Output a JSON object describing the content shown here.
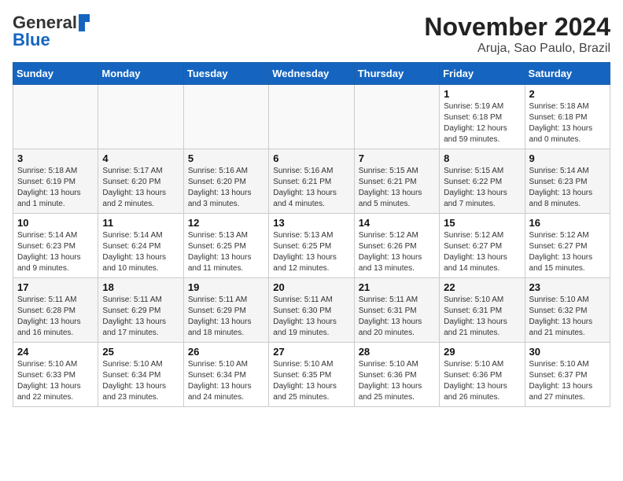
{
  "header": {
    "logo_general": "General",
    "logo_blue": "Blue",
    "title": "November 2024",
    "subtitle": "Aruja, Sao Paulo, Brazil"
  },
  "weekdays": [
    "Sunday",
    "Monday",
    "Tuesday",
    "Wednesday",
    "Thursday",
    "Friday",
    "Saturday"
  ],
  "weeks": [
    [
      {
        "day": "",
        "info": ""
      },
      {
        "day": "",
        "info": ""
      },
      {
        "day": "",
        "info": ""
      },
      {
        "day": "",
        "info": ""
      },
      {
        "day": "",
        "info": ""
      },
      {
        "day": "1",
        "info": "Sunrise: 5:19 AM\nSunset: 6:18 PM\nDaylight: 12 hours\nand 59 minutes."
      },
      {
        "day": "2",
        "info": "Sunrise: 5:18 AM\nSunset: 6:18 PM\nDaylight: 13 hours\nand 0 minutes."
      }
    ],
    [
      {
        "day": "3",
        "info": "Sunrise: 5:18 AM\nSunset: 6:19 PM\nDaylight: 13 hours\nand 1 minute."
      },
      {
        "day": "4",
        "info": "Sunrise: 5:17 AM\nSunset: 6:20 PM\nDaylight: 13 hours\nand 2 minutes."
      },
      {
        "day": "5",
        "info": "Sunrise: 5:16 AM\nSunset: 6:20 PM\nDaylight: 13 hours\nand 3 minutes."
      },
      {
        "day": "6",
        "info": "Sunrise: 5:16 AM\nSunset: 6:21 PM\nDaylight: 13 hours\nand 4 minutes."
      },
      {
        "day": "7",
        "info": "Sunrise: 5:15 AM\nSunset: 6:21 PM\nDaylight: 13 hours\nand 5 minutes."
      },
      {
        "day": "8",
        "info": "Sunrise: 5:15 AM\nSunset: 6:22 PM\nDaylight: 13 hours\nand 7 minutes."
      },
      {
        "day": "9",
        "info": "Sunrise: 5:14 AM\nSunset: 6:23 PM\nDaylight: 13 hours\nand 8 minutes."
      }
    ],
    [
      {
        "day": "10",
        "info": "Sunrise: 5:14 AM\nSunset: 6:23 PM\nDaylight: 13 hours\nand 9 minutes."
      },
      {
        "day": "11",
        "info": "Sunrise: 5:14 AM\nSunset: 6:24 PM\nDaylight: 13 hours\nand 10 minutes."
      },
      {
        "day": "12",
        "info": "Sunrise: 5:13 AM\nSunset: 6:25 PM\nDaylight: 13 hours\nand 11 minutes."
      },
      {
        "day": "13",
        "info": "Sunrise: 5:13 AM\nSunset: 6:25 PM\nDaylight: 13 hours\nand 12 minutes."
      },
      {
        "day": "14",
        "info": "Sunrise: 5:12 AM\nSunset: 6:26 PM\nDaylight: 13 hours\nand 13 minutes."
      },
      {
        "day": "15",
        "info": "Sunrise: 5:12 AM\nSunset: 6:27 PM\nDaylight: 13 hours\nand 14 minutes."
      },
      {
        "day": "16",
        "info": "Sunrise: 5:12 AM\nSunset: 6:27 PM\nDaylight: 13 hours\nand 15 minutes."
      }
    ],
    [
      {
        "day": "17",
        "info": "Sunrise: 5:11 AM\nSunset: 6:28 PM\nDaylight: 13 hours\nand 16 minutes."
      },
      {
        "day": "18",
        "info": "Sunrise: 5:11 AM\nSunset: 6:29 PM\nDaylight: 13 hours\nand 17 minutes."
      },
      {
        "day": "19",
        "info": "Sunrise: 5:11 AM\nSunset: 6:29 PM\nDaylight: 13 hours\nand 18 minutes."
      },
      {
        "day": "20",
        "info": "Sunrise: 5:11 AM\nSunset: 6:30 PM\nDaylight: 13 hours\nand 19 minutes."
      },
      {
        "day": "21",
        "info": "Sunrise: 5:11 AM\nSunset: 6:31 PM\nDaylight: 13 hours\nand 20 minutes."
      },
      {
        "day": "22",
        "info": "Sunrise: 5:10 AM\nSunset: 6:31 PM\nDaylight: 13 hours\nand 21 minutes."
      },
      {
        "day": "23",
        "info": "Sunrise: 5:10 AM\nSunset: 6:32 PM\nDaylight: 13 hours\nand 21 minutes."
      }
    ],
    [
      {
        "day": "24",
        "info": "Sunrise: 5:10 AM\nSunset: 6:33 PM\nDaylight: 13 hours\nand 22 minutes."
      },
      {
        "day": "25",
        "info": "Sunrise: 5:10 AM\nSunset: 6:34 PM\nDaylight: 13 hours\nand 23 minutes."
      },
      {
        "day": "26",
        "info": "Sunrise: 5:10 AM\nSunset: 6:34 PM\nDaylight: 13 hours\nand 24 minutes."
      },
      {
        "day": "27",
        "info": "Sunrise: 5:10 AM\nSunset: 6:35 PM\nDaylight: 13 hours\nand 25 minutes."
      },
      {
        "day": "28",
        "info": "Sunrise: 5:10 AM\nSunset: 6:36 PM\nDaylight: 13 hours\nand 25 minutes."
      },
      {
        "day": "29",
        "info": "Sunrise: 5:10 AM\nSunset: 6:36 PM\nDaylight: 13 hours\nand 26 minutes."
      },
      {
        "day": "30",
        "info": "Sunrise: 5:10 AM\nSunset: 6:37 PM\nDaylight: 13 hours\nand 27 minutes."
      }
    ]
  ]
}
